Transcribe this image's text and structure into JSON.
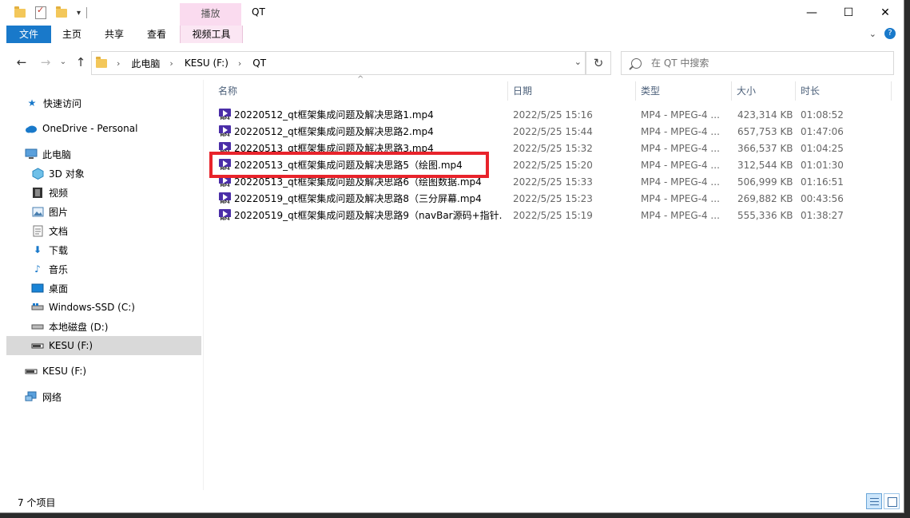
{
  "window": {
    "title": "QT",
    "contextual_tab_group": "播放",
    "controls": {
      "minimize": "—",
      "maximize": "☐",
      "close": "✕"
    }
  },
  "ribbon": {
    "tabs": [
      "文件",
      "主页",
      "共享",
      "查看",
      "视频工具"
    ],
    "expand_glyph": "⌄",
    "help_glyph": "?"
  },
  "address": {
    "back": "←",
    "forward": "→",
    "dropdown": "⌄",
    "up": "↑",
    "crumbs": [
      "此电脑",
      "KESU (F:)",
      "QT"
    ],
    "separator": "›",
    "dropdown_glyph": "⌄",
    "refresh": "↻"
  },
  "search": {
    "placeholder": "在 QT 中搜索"
  },
  "nav": {
    "items": [
      {
        "label": "快速访问",
        "icon": "star-icon"
      },
      {
        "label": "OneDrive - Personal",
        "icon": "cloud-icon"
      },
      {
        "label": "此电脑",
        "icon": "computer-icon"
      },
      {
        "label": "3D 对象",
        "icon": "cube-icon"
      },
      {
        "label": "视频",
        "icon": "video-icon"
      },
      {
        "label": "图片",
        "icon": "picture-icon"
      },
      {
        "label": "文档",
        "icon": "document-icon"
      },
      {
        "label": "下载",
        "icon": "download-icon"
      },
      {
        "label": "音乐",
        "icon": "music-icon"
      },
      {
        "label": "桌面",
        "icon": "desktop-icon"
      },
      {
        "label": "Windows-SSD (C:)",
        "icon": "drive-icon"
      },
      {
        "label": "本地磁盘 (D:)",
        "icon": "drive-icon"
      },
      {
        "label": "KESU (F:)",
        "icon": "usb-drive-icon"
      },
      {
        "label": "KESU (F:)",
        "icon": "usb-drive-icon"
      },
      {
        "label": "网络",
        "icon": "network-icon"
      }
    ]
  },
  "columns": {
    "name": "名称",
    "date": "日期",
    "type": "类型",
    "size": "大小",
    "duration": "时长",
    "sort_glyph": "^"
  },
  "files": [
    {
      "name": "20220512_qt框架集成问题及解决思路1.mp4",
      "date": "2022/5/25 15:16",
      "type": "MP4 - MPEG-4 ...",
      "size": "423,314 KB",
      "duration": "01:08:52"
    },
    {
      "name": "20220512_qt框架集成问题及解决思路2.mp4",
      "date": "2022/5/25 15:44",
      "type": "MP4 - MPEG-4 ...",
      "size": "657,753 KB",
      "duration": "01:47:06"
    },
    {
      "name": "20220513_qt框架集成问题及解决思路3.mp4",
      "date": "2022/5/25 15:32",
      "type": "MP4 - MPEG-4 ...",
      "size": "366,537 KB",
      "duration": "01:04:25"
    },
    {
      "name": "20220513_qt框架集成问题及解决思路5（绘图.mp4",
      "date": "2022/5/25 15:20",
      "type": "MP4 - MPEG-4 ...",
      "size": "312,544 KB",
      "duration": "01:01:30"
    },
    {
      "name": "20220513_qt框架集成问题及解决思路6（绘图数据.mp4",
      "date": "2022/5/25 15:33",
      "type": "MP4 - MPEG-4 ...",
      "size": "506,999 KB",
      "duration": "01:16:51"
    },
    {
      "name": "20220519_qt框架集成问题及解决思路8（三分屏幕.mp4",
      "date": "2022/5/25 15:23",
      "type": "MP4 - MPEG-4 ...",
      "size": "269,882 KB",
      "duration": "00:43:56"
    },
    {
      "name": "20220519_qt框架集成问题及解决思路9（navBar源码+指针...",
      "date": "2022/5/25 15:19",
      "type": "MP4 - MPEG-4 ...",
      "size": "555,336 KB",
      "duration": "01:38:27"
    }
  ],
  "status": {
    "item_count": "7 个项目"
  },
  "colors": {
    "accent": "#1979ca",
    "highlight": "#e8232b",
    "context_tab": "#fadbef"
  }
}
